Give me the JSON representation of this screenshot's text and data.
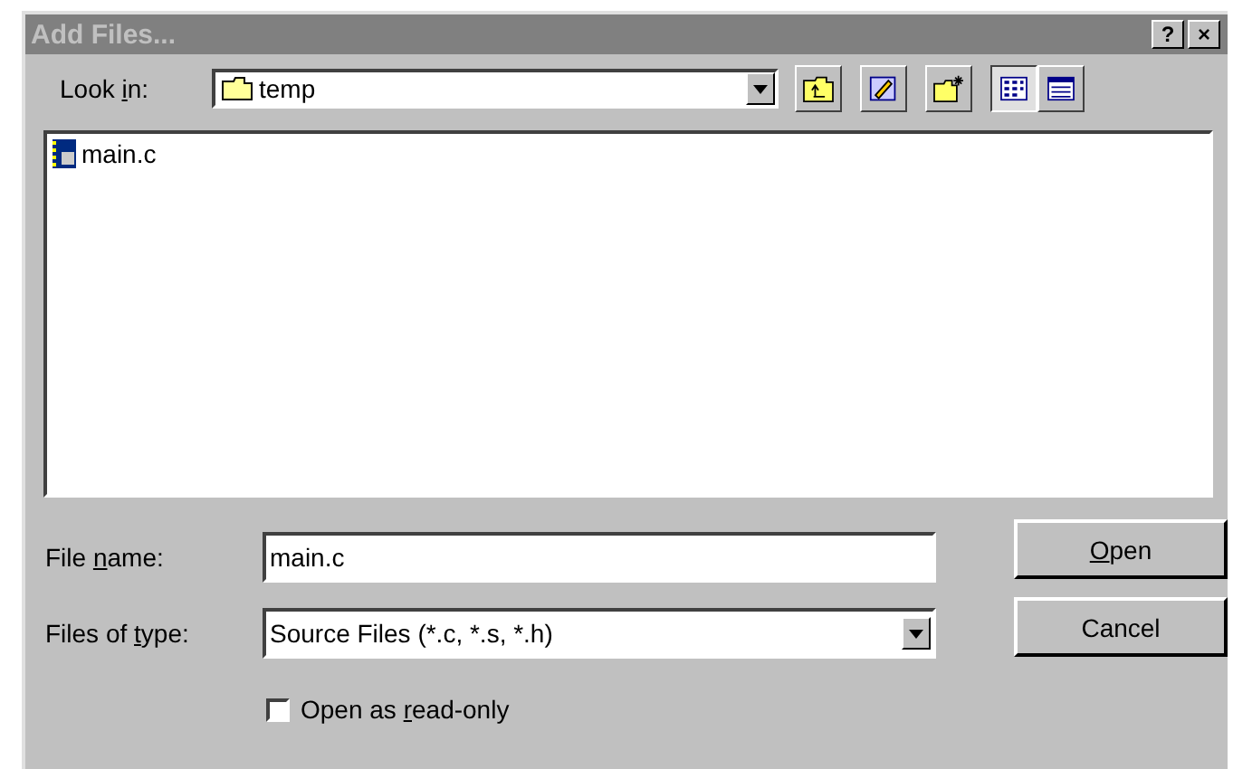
{
  "window": {
    "title": "Add Files...",
    "help_button": "?",
    "close_button": "×"
  },
  "look_in": {
    "label_before": "Look ",
    "access_key": "i",
    "label_after": "n:",
    "value": "temp"
  },
  "files": [
    {
      "name": "main.c",
      "selected": false
    }
  ],
  "file_name": {
    "label_before": "File ",
    "access_key": "n",
    "label_after": "ame:",
    "value": "main.c"
  },
  "file_type": {
    "label_before": "Files of ",
    "access_key": "t",
    "label_after": "ype:",
    "value": "Source Files (*.c, *.s, *.h)"
  },
  "read_only": {
    "label_before": "Open as ",
    "access_key": "r",
    "label_after": "ead-only",
    "checked": false
  },
  "buttons": [
    {
      "access_key": "O",
      "label_after": "pen"
    },
    {
      "label_before": "Cancel"
    }
  ]
}
